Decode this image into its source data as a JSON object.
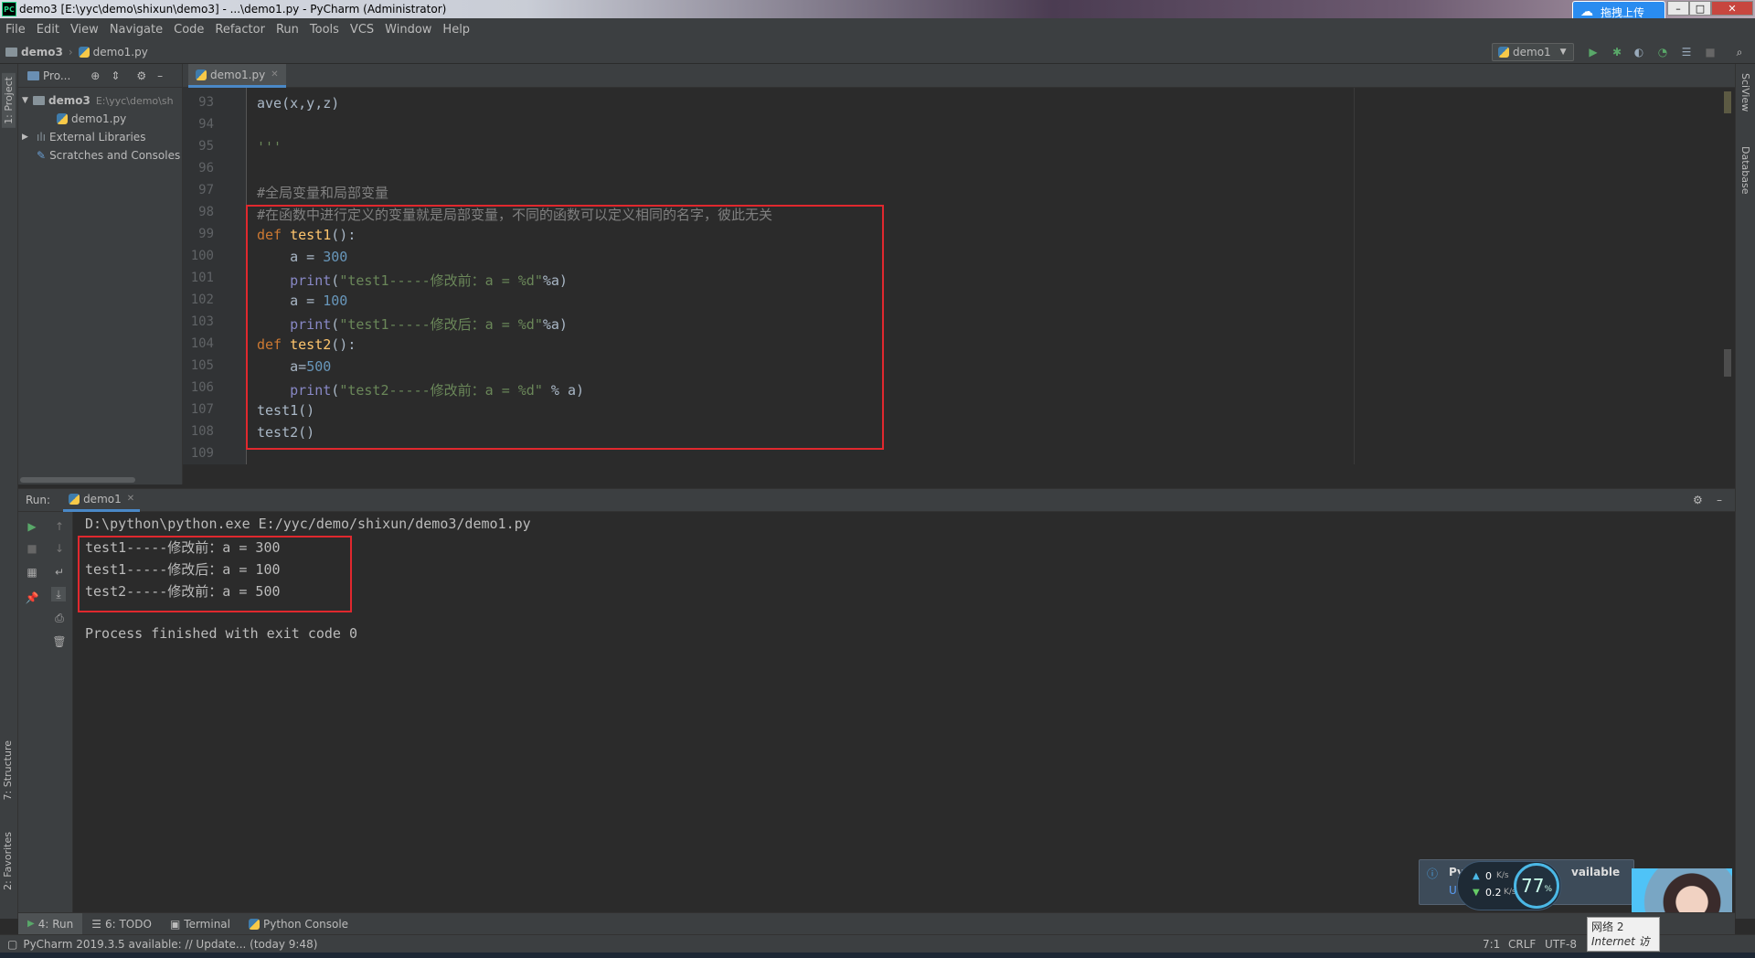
{
  "window": {
    "title": "demo3 [E:\\yyc\\demo\\shixun\\demo3] - ...\\demo1.py - PyCharm (Administrator)",
    "app_badge": "PC",
    "upload_label": "拖拽上传"
  },
  "menu": [
    "File",
    "Edit",
    "View",
    "Navigate",
    "Code",
    "Refactor",
    "Run",
    "Tools",
    "VCS",
    "Window",
    "Help"
  ],
  "nav": {
    "project": "demo3",
    "file": "demo1.py",
    "run_config": "demo1"
  },
  "left_tabs": {
    "project": "1: Project",
    "structure": "7: Structure",
    "favorites": "2: Favorites"
  },
  "right_tabs": {
    "sciview": "SciView",
    "database": "Database"
  },
  "project_panel": {
    "header": "Pro...",
    "tree": [
      {
        "label": "demo3",
        "path": "E:\\yyc\\demo\\sh"
      },
      {
        "label": "demo1.py"
      },
      {
        "label": "External Libraries"
      },
      {
        "label": "Scratches and Consoles"
      }
    ]
  },
  "editor": {
    "tab": "demo1.py",
    "line_numbers": [
      "93",
      "94",
      "95",
      "96",
      "97",
      "98",
      "99",
      "100",
      "101",
      "102",
      "103",
      "104",
      "105",
      "106",
      "107",
      "108",
      "109"
    ]
  },
  "run": {
    "label": "Run:",
    "tab": "demo1",
    "command": "D:\\python\\python.exe E:/yyc/demo/shixun/demo3/demo1.py",
    "output": [
      "test1-----修改前：a = 300",
      "test1-----修改后：a = 100",
      "test2-----修改前：a = 500"
    ],
    "exit": "Process finished with exit code 0"
  },
  "bottom_tabs": [
    "4: Run",
    "6: TODO",
    "Terminal",
    "Python Console"
  ],
  "status": {
    "message": "PyCharm 2019.3.5 available: // Update... (today 9:48)",
    "position": "7:1",
    "line_sep": "CRLF",
    "encoding": "UTF-8"
  },
  "notification": {
    "left": "Py",
    "right": "vailable",
    "sub": "U"
  },
  "net_widget": {
    "up": "0",
    "up_unit": "K/s",
    "down": "0.2",
    "down_unit": "K/s",
    "percent": "77",
    "percent_unit": "%"
  },
  "network_popup": {
    "line1": "网络  2",
    "line2": "Internet 访"
  }
}
